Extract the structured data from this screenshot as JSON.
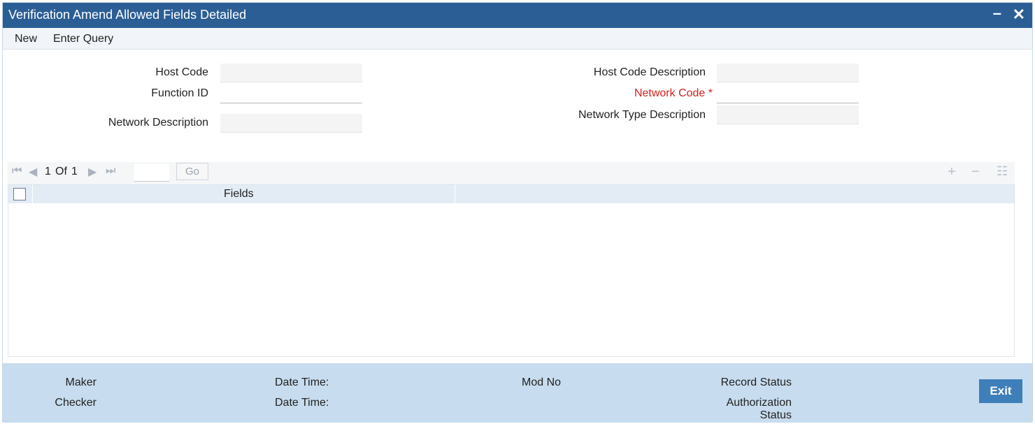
{
  "window": {
    "title": "Verification Amend Allowed Fields Detailed",
    "minimize_glyph": "▬",
    "close_glyph": "✕"
  },
  "menu": {
    "new": "New",
    "enter_query": "Enter Query"
  },
  "form": {
    "host_code": {
      "label": "Host Code",
      "value": ""
    },
    "host_code_description": {
      "label": "Host Code Description",
      "value": ""
    },
    "function_id": {
      "label": "Function ID",
      "value": ""
    },
    "network_code": {
      "label": "Network Code *",
      "value": "",
      "required": true
    },
    "network_description": {
      "label": "Network Description",
      "value": ""
    },
    "network_type_description": {
      "label": "Network Type Description",
      "value": ""
    }
  },
  "grid": {
    "pagination": {
      "current": "1",
      "of_label": "Of",
      "total": "1",
      "page_input": "",
      "go_label": "Go"
    },
    "icons": [
      "first-page-icon",
      "previous-page-icon",
      "next-page-icon",
      "last-page-icon",
      "add-row-icon",
      "delete-row-icon",
      "single-view-icon"
    ],
    "columns": [
      "Fields"
    ],
    "rows": []
  },
  "footer": {
    "maker": "Maker",
    "checker": "Checker",
    "date_time_1": "Date Time:",
    "date_time_2": "Date Time:",
    "mod_no": "Mod No",
    "record_status": "Record Status",
    "authorization_status_line1": "Authorization",
    "authorization_status_line2": "Status",
    "exit": "Exit"
  },
  "colors": {
    "titlebar": "#2b5e94",
    "required_label": "#d11f1f",
    "footer_bg": "#c7dcee",
    "exit_button": "#3f7fb9"
  }
}
